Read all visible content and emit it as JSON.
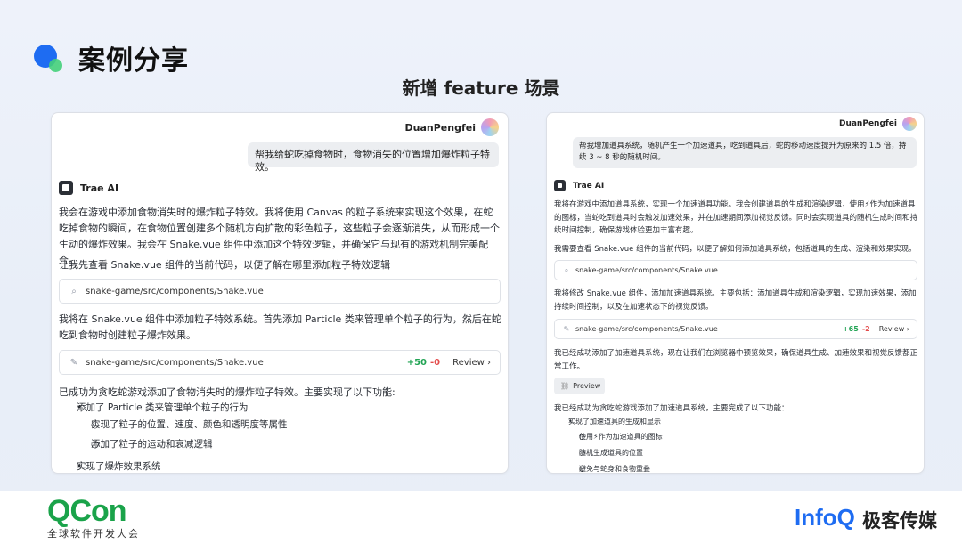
{
  "header": {
    "title": "案例分享",
    "subtitle": "新增 feature 场景"
  },
  "left": {
    "user_name": "DuanPengfei",
    "user_message": "帮我给蛇吃掉食物时，食物消失的位置增加爆炸粒子特效。",
    "ai_name": "Trae AI",
    "para1": "我会在游戏中添加食物消失时的爆炸粒子特效。我将使用 Canvas 的粒子系统来实现这个效果，在蛇吃掉食物的瞬间，在食物位置创建多个随机方向扩散的彩色粒子，这些粒子会逐渐消失，从而形成一个生动的爆炸效果。我会在 Snake.vue 组件中添加这个特效逻辑，并确保它与现有的游戏机制完美配合。",
    "para2": "让我先查看 Snake.vue 组件的当前代码，以便了解在哪里添加粒子特效逻辑",
    "search_file": "snake-game/src/components/Snake.vue",
    "para3": "我将在 Snake.vue 组件中添加粒子特效系统。首先添加 Particle 类来管理单个粒子的行为，然后在蛇吃到食物时创建粒子爆炸效果。",
    "edit_file": "snake-game/src/components/Snake.vue",
    "diff_plus": "+50",
    "diff_minus": "-0",
    "review_label": "Review",
    "para4": "已成功为贪吃蛇游戏添加了食物消失时的爆炸粒子特效。主要实现了以下功能:",
    "bullets": [
      "添加了 Particle 类来管理单个粒子的行为",
      "实现了粒子的位置、速度、颜色和透明度等属性",
      "添加了粒子的运动和衰减逻辑",
      "实现了爆炸效果系统"
    ]
  },
  "right": {
    "user_name": "DuanPengfei",
    "user_message": "帮我增加道具系统，随机产生一个加速道具，吃到道具后，蛇的移动速度提升为原来的 1.5 倍，持续 3 ~ 8 秒的随机时间。",
    "ai_name": "Trae AI",
    "para1": "我将在游戏中添加道具系统，实现一个加速道具功能。我会创建道具的生成和渲染逻辑，使用⚡作为加速道具的图标，当蛇吃到道具时会触发加速效果，并在加速期间添加视觉反馈。同时会实现道具的随机生成时间和持续时间控制，确保游戏体验更加丰富有趣。",
    "para2": "我需要查看 Snake.vue 组件的当前代码，以便了解如何添加道具系统，包括道具的生成、渲染和效果实现。",
    "search_file": "snake-game/src/components/Snake.vue",
    "para3": "我将修改 Snake.vue 组件，添加加速道具系统。主要包括：添加道具生成和渲染逻辑，实现加速效果，添加持续时间控制，以及在加速状态下的视觉反馈。",
    "edit_file": "snake-game/src/components/Snake.vue",
    "diff_plus": "+65",
    "diff_minus": "-2",
    "review_label": "Review",
    "para4": "我已经成功添加了加速道具系统，现在让我们在浏览器中预览效果，确保道具生成、加速效果和视觉反馈都正常工作。",
    "preview_label": "Preview",
    "para5": "我已经成功为贪吃蛇游戏添加了加速道具系统，主要完成了以下功能：",
    "bullets": [
      "实现了加速道具的生成和显示",
      "使用⚡作为加速道具的图标",
      "随机生成道具的位置",
      "避免与蛇身和食物重叠"
    ]
  },
  "footer": {
    "qcon": "QCon",
    "qcon_sub": "全球软件开发大会",
    "infoq": "InfoQ",
    "infoq_cn": "极客传媒"
  },
  "colors": {
    "accent_blue": "#1e6cf2",
    "accent_green": "#1aa34a",
    "diff_plus": "#23a455",
    "diff_minus": "#e34d4d"
  }
}
